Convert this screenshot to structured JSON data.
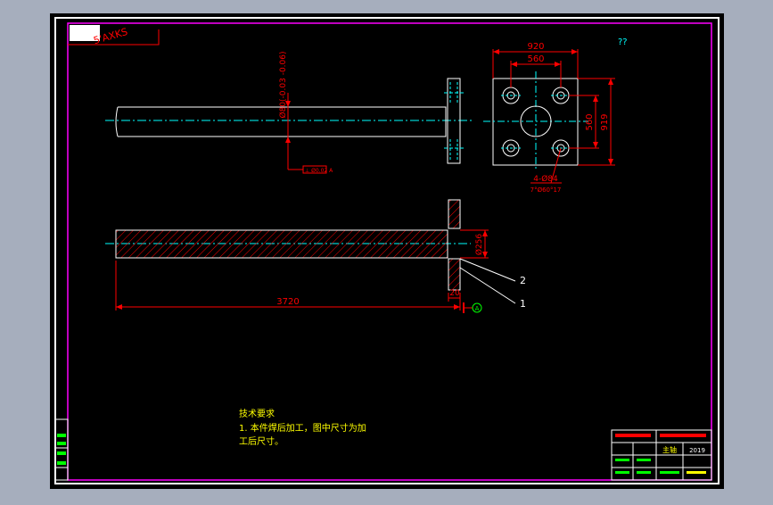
{
  "drawing": {
    "corner_label": "5'AXKS",
    "question_marks": "??",
    "shaft_dim_label": "Ø80(-0.03 -0.06)",
    "tolerance_frame": "⊥ Ø0.02 A",
    "plate": {
      "width_outer": "920",
      "width_inner": "560",
      "height_inner": "560",
      "height_outer": "919",
      "holes": "4-Ø84",
      "holes_sub": "7°Ø60°17"
    },
    "section": {
      "diameter": "Ø256",
      "length": "3720",
      "flange_thickness": "20",
      "datum": "A",
      "balloon_1": "1",
      "balloon_2": "2"
    },
    "notes": {
      "heading": "技术要求",
      "line1": "1. 本件焊后加工，图中尺寸为加",
      "line2": "工后尺寸。"
    },
    "title_block": {
      "name": "主轴",
      "code": "2019"
    }
  },
  "colors": {
    "background": "#000000",
    "outer_frame": "#ffffff",
    "inner_frame": "#ff00ff",
    "dimension": "#ff0000",
    "centerline": "#00ffff",
    "outline": "#ffffff",
    "notes_text": "#ffff00",
    "hatch": "#ff0000"
  }
}
